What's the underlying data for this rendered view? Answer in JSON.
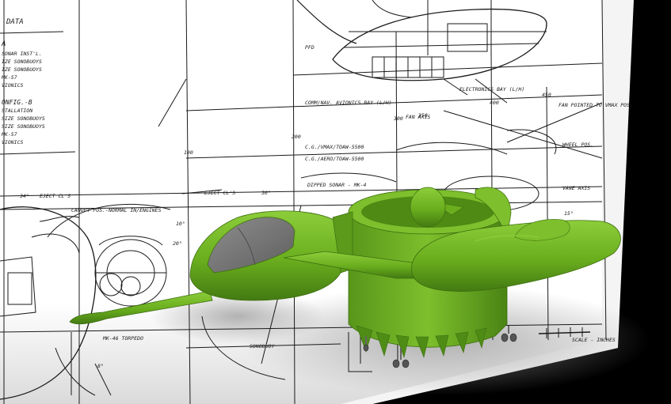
{
  "scene": {
    "subject": "VTOL ASW aircraft 3D model over engineering blueprint",
    "model_color": "#6aae1e",
    "model_shadow": "#3d6e10",
    "canopy_color": "#7a7a7a",
    "paper_color": "#ffffff",
    "line_color": "#1a1a1a",
    "backdrop_color": "#000000"
  },
  "blueprint": {
    "data_heading": "DATA",
    "data_block_a": [
      "A",
      "SONAR INST'L.",
      "IZE SONOBUOYS",
      "IZE SONOBUOYS",
      "MK-57",
      "VIONICS"
    ],
    "data_block_b": [
      "ONFIG.-B",
      "STALLATION",
      "SIZE SONOBUOYS",
      "SIZE SONOBUOYS",
      "MK-57",
      "VIONICS"
    ],
    "labels": {
      "eject_left": "EJECT CL'S",
      "canopy_pos": "CANOPY POS.-NORMAL IN/ENGINES",
      "eject_center": "EJECT CL'S",
      "dipped_sonar": "DIPPED SONAR - MK-4",
      "cb_vmax": "C.G./VMAX/TOAW-5500",
      "cb_aero": "C.G./AERO/TOAW-5500",
      "comm_avionics": "COMM/NAV. AVIONICS BAY (L/H)",
      "elec_bay": "ELECTRONICS BAY (L/H)",
      "fan_pointed": "FAN POINTED TO VMAX POS.",
      "pfd": "PFD",
      "mk46": "MK-46 TORPEDO",
      "sonobuoy": "SONOBUOY",
      "scale": "SCALE - INCHES",
      "wheel_pos": "WHEEL POS.",
      "vane_axis": "VANE AXIS",
      "fan_axis": "FAN AXIS"
    },
    "numbers": {
      "n100": "100",
      "n200": "200",
      "n300": "300",
      "n350": "350",
      "n400": "400",
      "n450": "450",
      "angle_34": "34°",
      "angle_30": "30°",
      "angle_10": "10°",
      "angle_15": "15°",
      "angle_20": "20°",
      "angle_8": "8°"
    }
  }
}
